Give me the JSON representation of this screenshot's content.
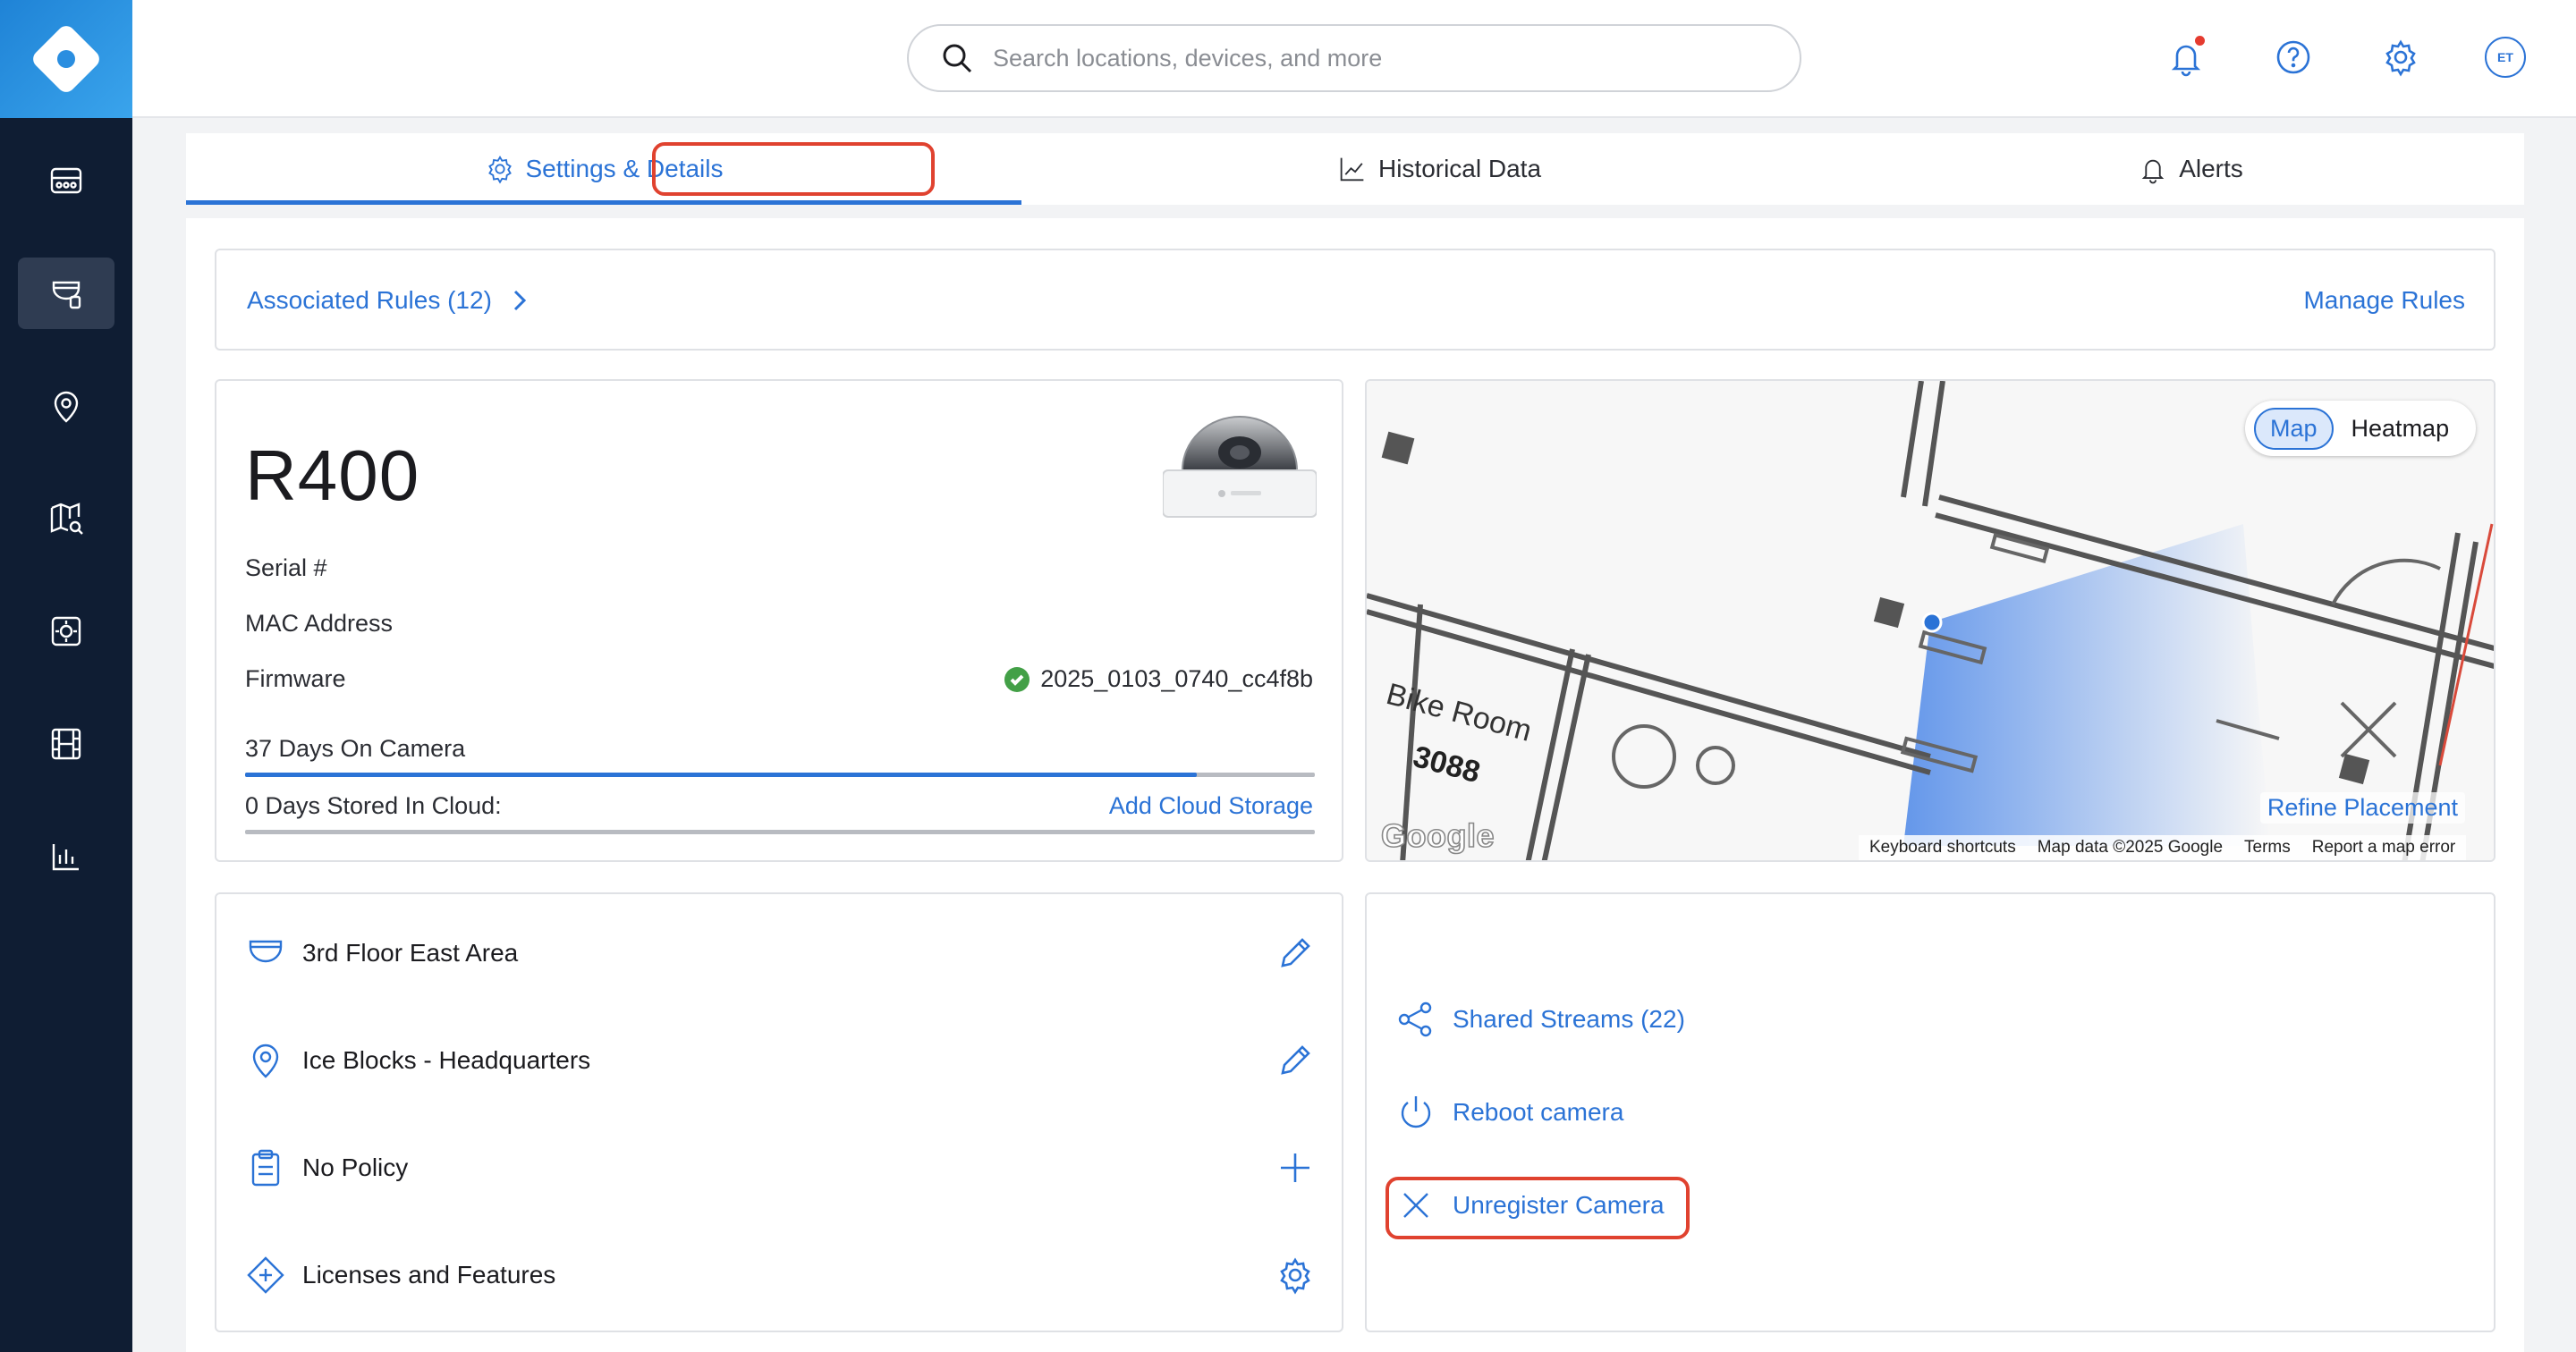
{
  "search": {
    "placeholder": "Search locations, devices, and more"
  },
  "header": {
    "avatar_initials": "ET"
  },
  "tabs": [
    {
      "label": "Settings & Details",
      "icon": "gear-icon",
      "active": true
    },
    {
      "label": "Historical Data",
      "icon": "chart-icon",
      "active": false
    },
    {
      "label": "Alerts",
      "icon": "bell-icon",
      "active": false
    }
  ],
  "rules": {
    "associated_label": "Associated Rules (12)",
    "manage_label": "Manage Rules"
  },
  "device": {
    "model": "R400",
    "serial_label": "Serial #",
    "mac_label": "MAC Address",
    "firmware_label": "Firmware",
    "firmware_value": "2025_0103_0740_cc4f8b",
    "days_on_camera_label": "37 Days On Camera",
    "days_on_camera_progress": 0.89,
    "cloud_label": "0 Days Stored In Cloud:",
    "cloud_progress": 0,
    "add_cloud_label": "Add Cloud Storage"
  },
  "map": {
    "map_option": "Map",
    "heatmap_option": "Heatmap",
    "refine_label": "Refine Placement",
    "room_label": "Bike Room",
    "room_number": "3088",
    "google_logo": "Google",
    "footer": {
      "shortcuts": "Keyboard shortcuts",
      "map_data": "Map data ©2025 Google",
      "terms": "Terms",
      "report": "Report a map error"
    }
  },
  "location": {
    "area": "3rd Floor East Area",
    "site": "Ice Blocks - Headquarters",
    "policy": "No Policy",
    "licenses": "Licenses and Features"
  },
  "actions": {
    "shared_streams": "Shared Streams (22)",
    "reboot": "Reboot camera",
    "unregister": "Unregister Camera"
  },
  "colors": {
    "accent": "#2b73d6",
    "sidebar": "#0f1d33",
    "highlight": "#e0422f",
    "success": "#43a047"
  }
}
